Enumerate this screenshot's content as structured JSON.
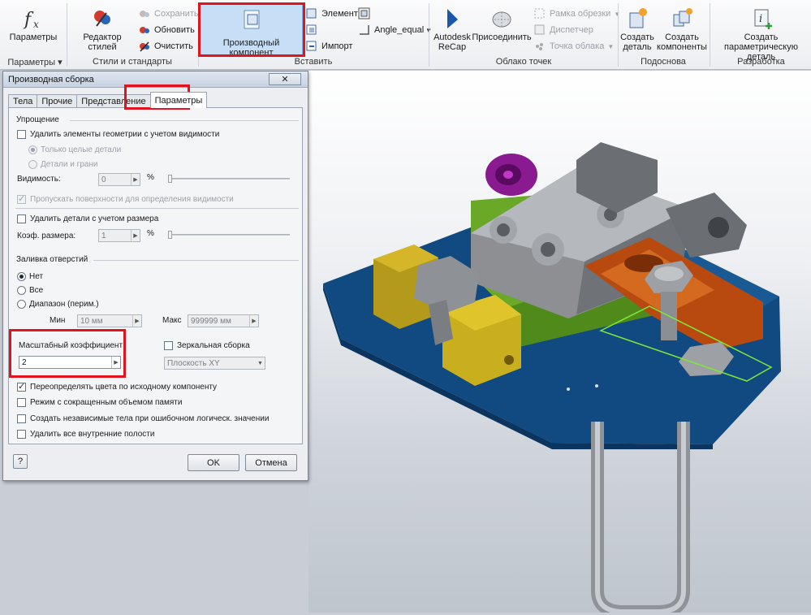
{
  "ribbon": {
    "params": {
      "label": "Параметры",
      "group": "Параметры"
    },
    "styles": {
      "editor": "Редактор стилей",
      "save": "Сохранить",
      "update": "Обновить",
      "clean": "Очистить",
      "group": "Стили и стандарты"
    },
    "insert": {
      "derived": "Производный компонент",
      "element": "Элемент",
      "angle": "Angle_equal",
      "import": "Импорт",
      "group": "Вставить"
    },
    "cloud": {
      "recap": "Autodesk ReCap",
      "attach": "Присоединить",
      "crop": "Рамка обрезки",
      "dispatcher": "Диспетчер",
      "cloud_point": "Точка облака",
      "group": "Облако точек"
    },
    "base": {
      "create_part": "Создать деталь",
      "create_components": "Создать компоненты",
      "group": "Подоснова"
    },
    "dev": {
      "create_param_part": "Создать параметрическую деталь",
      "group": "Разработка"
    }
  },
  "dialog": {
    "title": "Производная сборка",
    "close": "✕",
    "tabs": [
      "Тела",
      "Прочие",
      "Представление",
      "Параметры"
    ],
    "simplify": {
      "header": "Упрощение",
      "remove_visible": "Удалить элементы геометрии с учетом видимости",
      "whole_parts": "Только целые детали",
      "parts_faces": "Детали и грани",
      "visibility_label": "Видимость:",
      "visibility_value": "0",
      "percent": "%",
      "skip_surfaces": "Пропускать поверхности для определения видимости",
      "remove_size": "Удалить детали с учетом размера",
      "size_factor_label": "Коэф. размера:",
      "size_factor_value": "1",
      "percent2": "%"
    },
    "holes": {
      "header": "Заливка отверстий",
      "none": "Нет",
      "all": "Все",
      "range": "Диапазон (перим.)",
      "min_label": "Мин",
      "min_value": "10 мм",
      "max_label": "Макс",
      "max_value": "999999 мм"
    },
    "scale": {
      "label": "Масштабный коэффициент",
      "value": "2"
    },
    "mirror": {
      "label": "Зеркальная сборка",
      "plane": "Плоскость XY"
    },
    "options": {
      "override_colors": "Переопределять цвета по исходному компоненту",
      "low_memory": "Режим с сокращенным объемом памяти",
      "independent_bodies": "Создать независимые тела при ошибочном логическ. значении",
      "remove_voids": "Удалить все внутренние полости"
    },
    "help": "?",
    "ok": "OK",
    "cancel": "Отмена"
  },
  "colors": {
    "highlight": "#e0141e",
    "ribbon_selected": "#c7def7",
    "base_plate": "#0d4d86"
  }
}
